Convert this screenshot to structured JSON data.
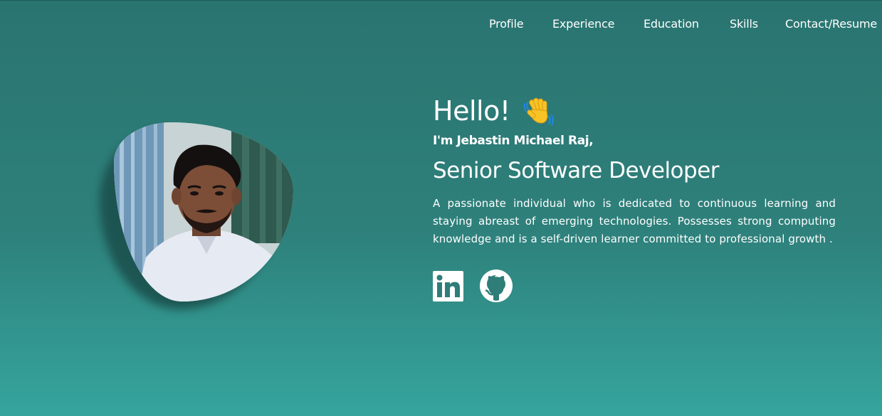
{
  "nav": {
    "items": [
      {
        "label": "Profile"
      },
      {
        "label": "Experience"
      },
      {
        "label": "Education"
      },
      {
        "label": "Skills"
      },
      {
        "label": "Contact/Resume"
      }
    ]
  },
  "hero": {
    "greeting": "Hello!",
    "greeting_icon": "waving-hand-icon",
    "intro": "I'm Jebastin Michael Raj,",
    "role": "Senior Software Developer",
    "description": "A passionate individual who is dedicated to continuous learning and staying abreast of emerging technologies. Possesses strong computing knowledge and is a self-driven learner committed to professional growth ."
  },
  "socials": [
    {
      "icon": "linkedin-icon"
    },
    {
      "icon": "github-icon"
    }
  ],
  "colors": {
    "background_top": "#2a7470",
    "background_bottom": "#35a59d",
    "text": "#ffffff"
  }
}
